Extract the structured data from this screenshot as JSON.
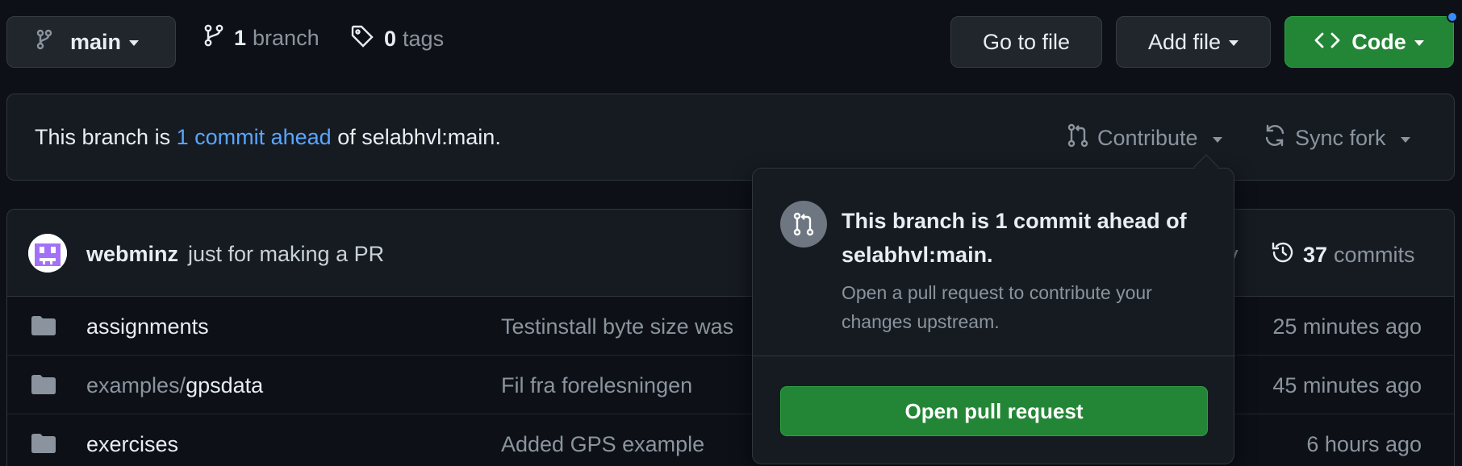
{
  "toolbar": {
    "branch_label": "main",
    "branch_count": "1",
    "branch_word": "branch",
    "tag_count": "0",
    "tag_word": "tags",
    "goto_file": "Go to file",
    "add_file": "Add file",
    "code": "Code"
  },
  "ahead": {
    "prefix": "This branch is",
    "link": "1 commit ahead",
    "suffix": "of selabhvl:main.",
    "contribute": "Contribute",
    "sync_fork": "Sync fork"
  },
  "commit": {
    "author": "webminz",
    "message": "just for making a PR",
    "obscured_tail": "v",
    "count": "37",
    "count_word": "commits"
  },
  "files": [
    {
      "dir": "",
      "name": "assignments",
      "message": "Testinstall byte size was",
      "age": "25 minutes ago"
    },
    {
      "dir": "examples/",
      "name": "gpsdata",
      "message": "Fil fra forelesningen",
      "age": "45 minutes ago"
    },
    {
      "dir": "",
      "name": "exercises",
      "message": "Added GPS example",
      "age": "6 hours ago"
    }
  ],
  "popover": {
    "title": "This branch is 1 commit ahead of selabhvl:main.",
    "description": "Open a pull request to contribute your changes upstream.",
    "button": "Open pull request"
  },
  "colors": {
    "background": "#0d1117",
    "link": "#58a6ff",
    "primary_button": "#238636"
  },
  "icons": {
    "branch": "git-branch-icon",
    "tag": "tag-icon",
    "code": "code-icon",
    "pr": "git-pull-request-icon",
    "sync": "sync-icon",
    "history": "history-icon",
    "folder": "folder-icon"
  }
}
